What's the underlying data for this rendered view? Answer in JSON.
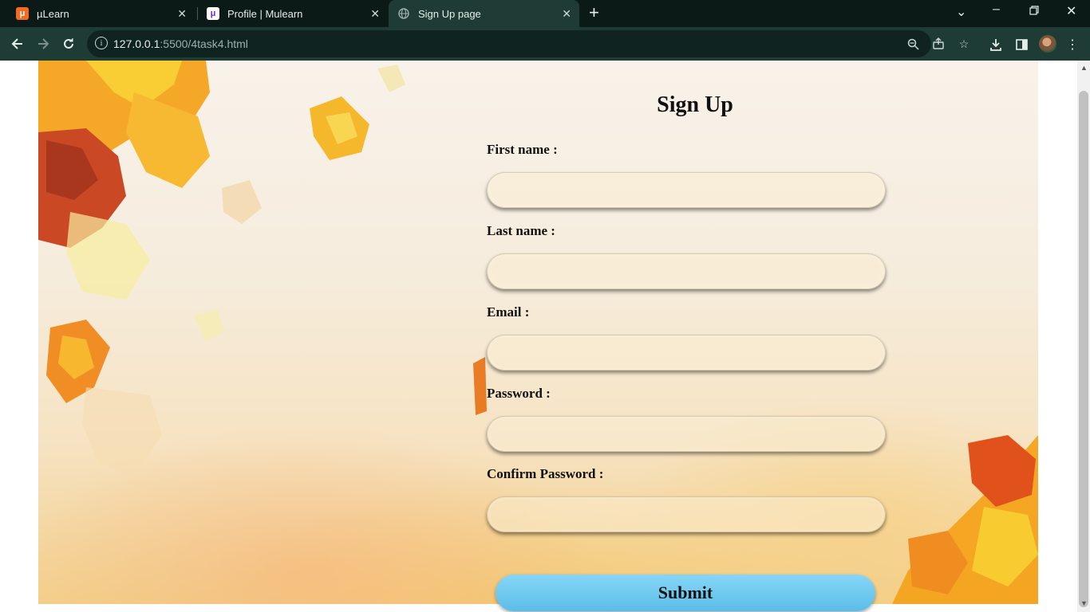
{
  "browser": {
    "tabs": [
      {
        "title": "µLearn",
        "icon": "mulearn-favicon"
      },
      {
        "title": "Profile | Mulearn",
        "icon": "mulearn-favicon"
      },
      {
        "title": "Sign Up page",
        "icon": "globe-icon",
        "active": true
      }
    ],
    "url_host": "127.0.0.1",
    "url_rest": ":5500/4task4.html"
  },
  "form": {
    "title": "Sign Up",
    "first_name_label": "First name :",
    "last_name_label": "Last name :",
    "email_label": "Email :",
    "password_label": "Password :",
    "confirm_password_label": "Confirm Password :",
    "first_name_value": "",
    "last_name_value": "",
    "email_value": "",
    "password_value": "",
    "confirm_password_value": "",
    "submit_label": "Submit"
  },
  "colors": {
    "tabbar_bg": "#0c1a17",
    "toolbar_bg": "#1e3b35",
    "submit_bg": "#6cc8ef"
  }
}
